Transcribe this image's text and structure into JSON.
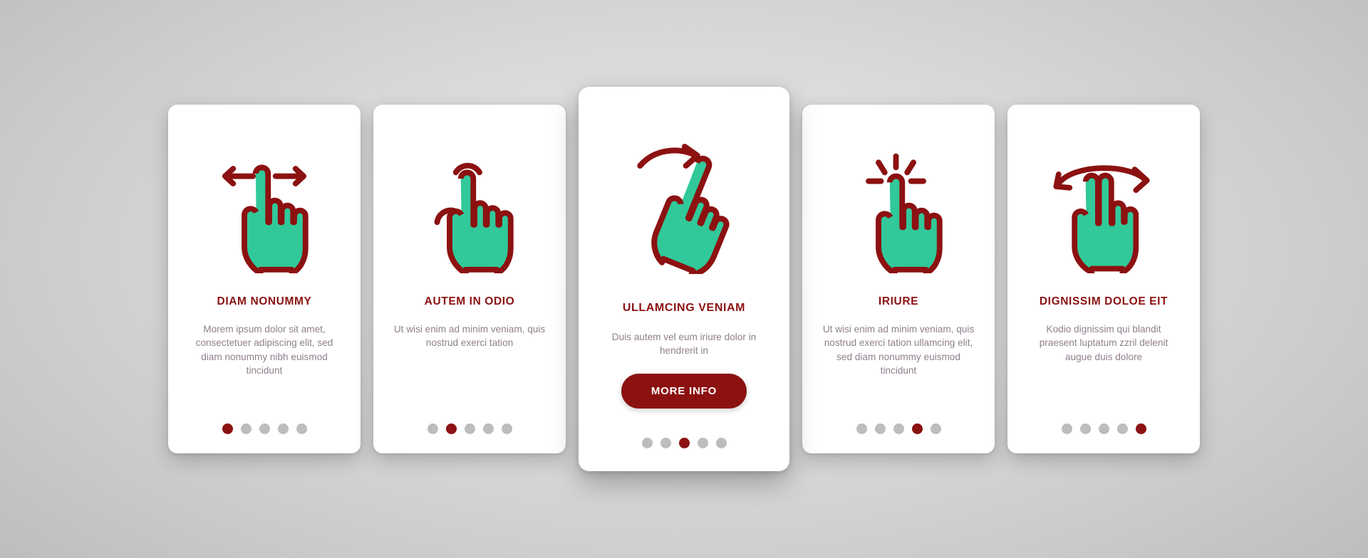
{
  "theme": {
    "accent_color": "#8C1111",
    "icon_green": "#31C99A",
    "icon_outline": "#8C1111",
    "body_text_color": "#8F7F8D",
    "dot_inactive_color": "#BDBDBD",
    "card_background": "#FFFFFF",
    "page_background": "#D6D6D6"
  },
  "cards": [
    {
      "id": "card-1",
      "icon_name": "swipe-horizontal-gesture-icon",
      "title": "DIAM NONUMMY",
      "body": "Morem ipsum dolor sit amet, consectetuer adipiscing elit, sed diam nonummy nibh euismod tincidunt",
      "dots": {
        "count": 5,
        "active_index": 0
      },
      "featured": false,
      "button": null
    },
    {
      "id": "card-2",
      "icon_name": "double-tap-gesture-icon",
      "title": "AUTEM IN ODIO",
      "body": "Ut wisi enim ad minim veniam, quis nostrud exerci tation",
      "dots": {
        "count": 5,
        "active_index": 1
      },
      "featured": false,
      "button": null
    },
    {
      "id": "card-3",
      "icon_name": "swipe-up-right-gesture-icon",
      "title": "ULLAMCING VENIAM",
      "body": "Duis autem vel eum iriure dolor in hendrerit in",
      "dots": {
        "count": 5,
        "active_index": 2
      },
      "featured": true,
      "button": {
        "label": "MORE INFO"
      }
    },
    {
      "id": "card-4",
      "icon_name": "tap-click-gesture-icon",
      "title": "IRIURE",
      "body": "Ut wisi enim ad minim veniam, quis nostrud exerci tation ullamcing elit, sed diam nonummy euismod tincidunt",
      "dots": {
        "count": 5,
        "active_index": 3
      },
      "featured": false,
      "button": null
    },
    {
      "id": "card-5",
      "icon_name": "two-finger-rotate-gesture-icon",
      "title": "DIGNISSIM DOLOE EIT",
      "body": "Kodio dignissim qui blandit praesent luptatum zzril delenit augue duis dolore",
      "dots": {
        "count": 5,
        "active_index": 4
      },
      "featured": false,
      "button": null
    }
  ]
}
